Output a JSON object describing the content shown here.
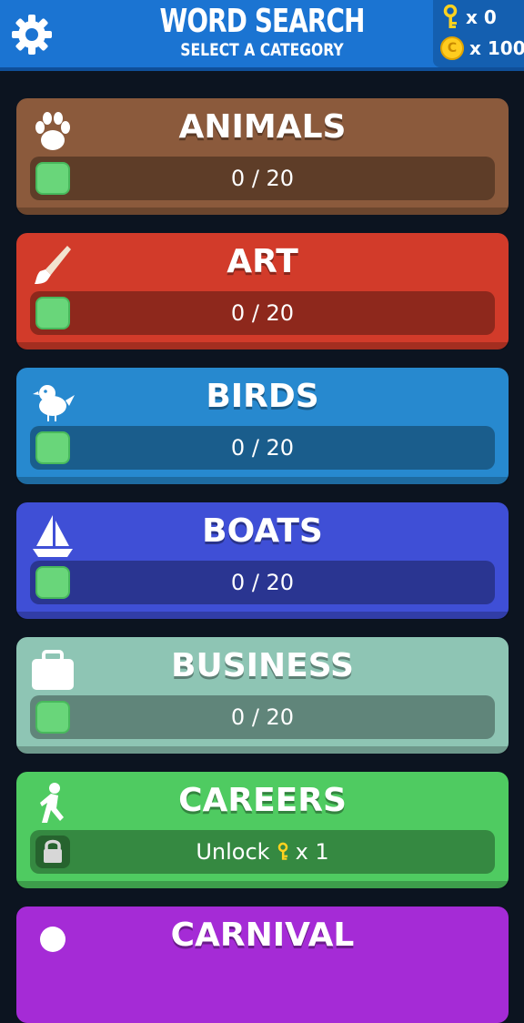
{
  "header": {
    "title": "WORD SEARCH",
    "subtitle": "SELECT A CATEGORY",
    "keys_count": "x 0",
    "coins_count": "x 100",
    "coin_symbol": "C"
  },
  "categories": [
    {
      "name": "ANIMALS",
      "icon": "paw-icon",
      "progress": "0 / 20",
      "color": "#8b5a3c"
    },
    {
      "name": "ART",
      "icon": "paintbrush-icon",
      "progress": "0 / 20",
      "color": "#d23b2a"
    },
    {
      "name": "BIRDS",
      "icon": "bird-icon",
      "progress": "0 / 20",
      "color": "#2789cf"
    },
    {
      "name": "BOATS",
      "icon": "sailboat-icon",
      "progress": "0 / 20",
      "color": "#3f4fd6"
    },
    {
      "name": "BUSINESS",
      "icon": "briefcase-icon",
      "progress": "0 / 20",
      "color": "#8ec5b4"
    },
    {
      "name": "CAREERS",
      "icon": "runner-icon",
      "unlock_label": "Unlock",
      "unlock_cost": "x 1",
      "color": "#4fcb61"
    },
    {
      "name": "CARNIVAL",
      "icon": "carnival-icon",
      "color": "#a52bd6"
    }
  ]
}
